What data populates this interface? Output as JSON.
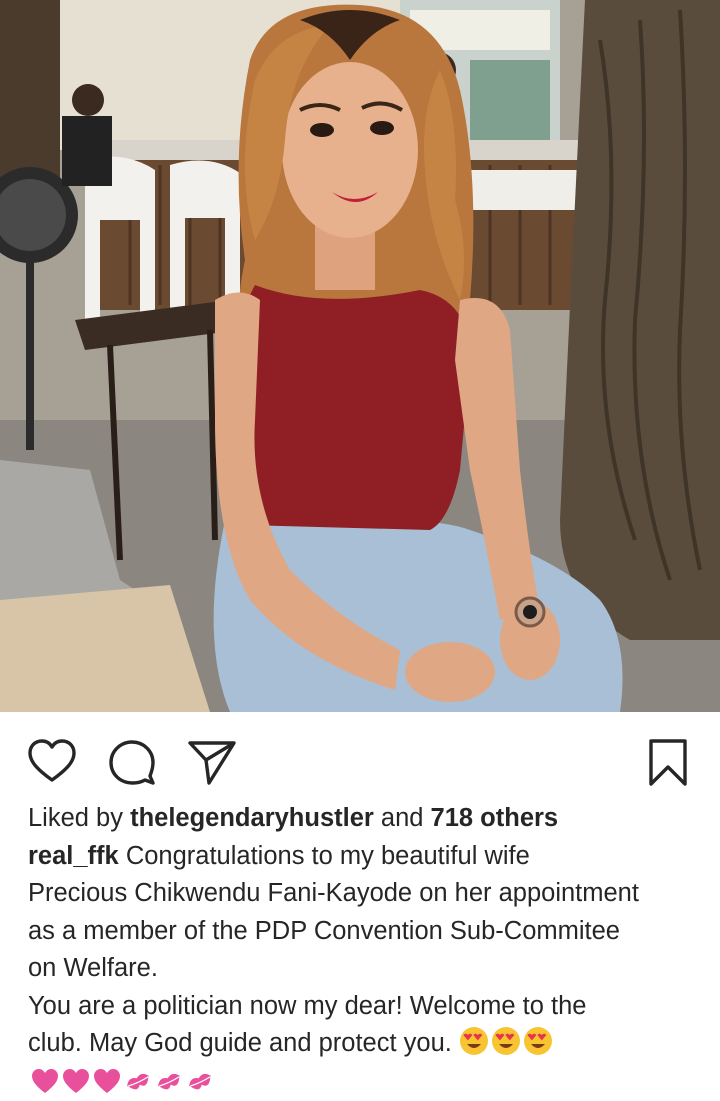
{
  "post": {
    "liked_by_prefix": "Liked by",
    "liked_by_user": "thelegendaryhustler",
    "liked_by_and": "and",
    "liked_by_others": "718 others",
    "caption_user": "real_ffk",
    "caption_line1": "Congratulations to my beautiful wife",
    "caption_line2": "Precious Chikwendu Fani-Kayode on her appointment",
    "caption_line3": "as a member of the PDP Convention Sub-Commitee",
    "caption_line4": "on Welfare.",
    "caption_line5": "You are a politician now my dear! Welcome to the",
    "caption_line6": "club. May God guide and protect you.",
    "caption_emojis": [
      "smiling-face-with-heart-eyes",
      "smiling-face-with-heart-eyes",
      "smiling-face-with-heart-eyes"
    ],
    "hearts_row": [
      "pink-heart",
      "pink-heart",
      "pink-heart",
      "kiss-mark",
      "kiss-mark",
      "kiss-mark"
    ]
  },
  "actions": {
    "like_icon": "heart-outline-icon",
    "comment_icon": "comment-bubble-icon",
    "share_icon": "paper-plane-icon",
    "save_icon": "bookmark-icon"
  },
  "colors": {
    "text": "#262626",
    "heart_pink": "#e9509c",
    "emoji_yellow": "#f7c531",
    "emoji_heart": "#e8344a"
  }
}
